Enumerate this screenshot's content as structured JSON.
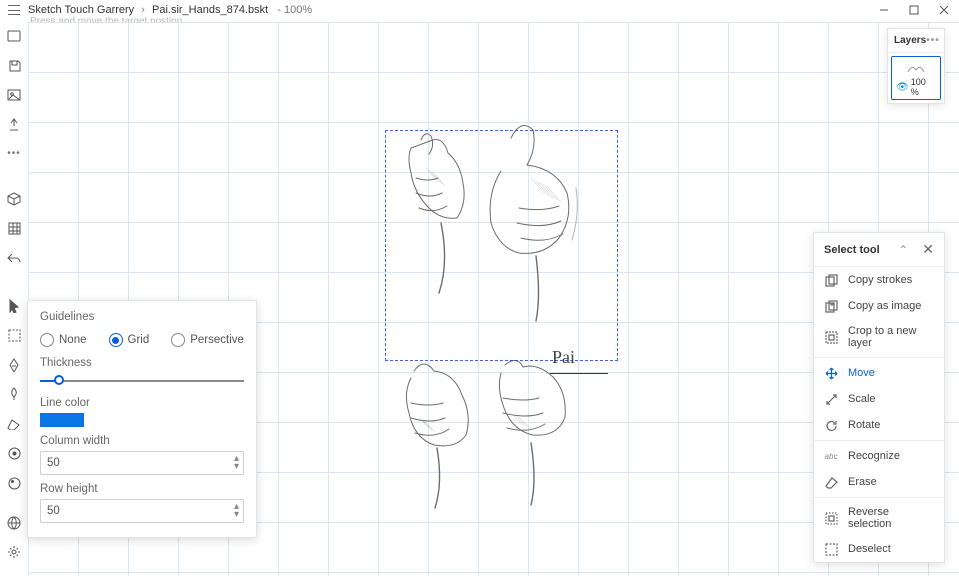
{
  "title": {
    "app": "Sketch Touch Garrery",
    "file": "Pai.sir_Hands_874.bskt",
    "zoom": "100%"
  },
  "hint": "Press and move the target postion",
  "layers": {
    "title": "Layers",
    "pct": "100 %"
  },
  "guidelines": {
    "title": "Guidelines",
    "none": "None",
    "grid": "Grid",
    "persp": "Persective",
    "thickness": "Thickness",
    "linecolor": "Line color",
    "colw": "Column width",
    "colw_val": "50",
    "rowh": "Row height",
    "rowh_val": "50"
  },
  "selecttool": {
    "title": "Select tool",
    "items": [
      {
        "label": "Copy strokes",
        "icon": "copy"
      },
      {
        "label": "Copy as image",
        "icon": "copyimg"
      },
      {
        "label": "Crop to a new layer",
        "icon": "crop"
      },
      {
        "label": "Move",
        "icon": "move",
        "active": true
      },
      {
        "label": "Scale",
        "icon": "scale"
      },
      {
        "label": "Rotate",
        "icon": "rotate"
      },
      {
        "label": "Recognize",
        "icon": "abc"
      },
      {
        "label": "Erase",
        "icon": "erase"
      },
      {
        "label": "Reverse selection",
        "icon": "reverse"
      },
      {
        "label": "Deselect",
        "icon": "deselect"
      }
    ]
  },
  "signature": "Pai"
}
